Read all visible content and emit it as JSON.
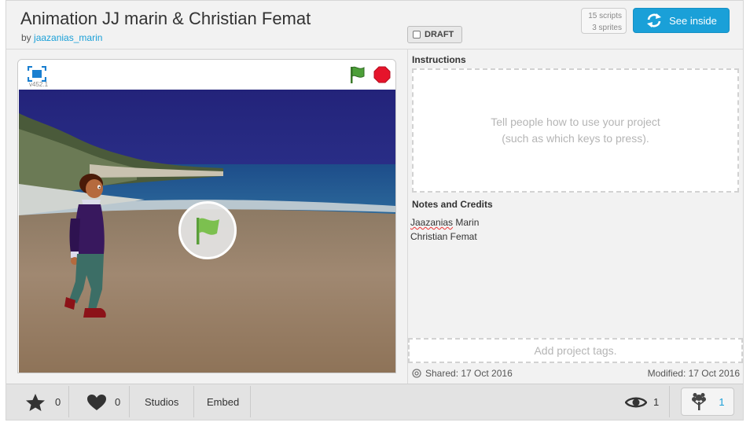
{
  "project": {
    "title": "Animation JJ marin & Christian Femat",
    "by_label": "by",
    "author": "jaazanias_marin",
    "draft_label": "DRAFT",
    "scripts_count": "15 scripts",
    "sprites_count": "3 sprites",
    "see_inside_label": "See inside"
  },
  "player": {
    "version": "v452.1",
    "icons": [
      "fullscreen-icon",
      "green-flag-icon",
      "stop-icon",
      "big-green-flag-icon"
    ]
  },
  "instructions": {
    "heading": "Instructions",
    "placeholder_line1": "Tell people how to use your project",
    "placeholder_line2": "(such as which keys to press)."
  },
  "notes": {
    "heading": "Notes and Credits",
    "line1_first": "Jaazanias",
    "line1_rest": " Marin",
    "line2": "Christian Femat"
  },
  "tags": {
    "placeholder": "Add project tags."
  },
  "dates": {
    "shared": "Shared: 17 Oct 2016",
    "modified": "Modified: 17 Oct 2016"
  },
  "bottom_bar": {
    "favorites": "0",
    "loves": "0",
    "studios_label": "Studios",
    "embed_label": "Embed",
    "views": "1",
    "remixes": "1"
  },
  "colors": {
    "accent": "#1aa0d8",
    "flag_green": "#4c9f38",
    "stop_red": "#e6142b"
  }
}
